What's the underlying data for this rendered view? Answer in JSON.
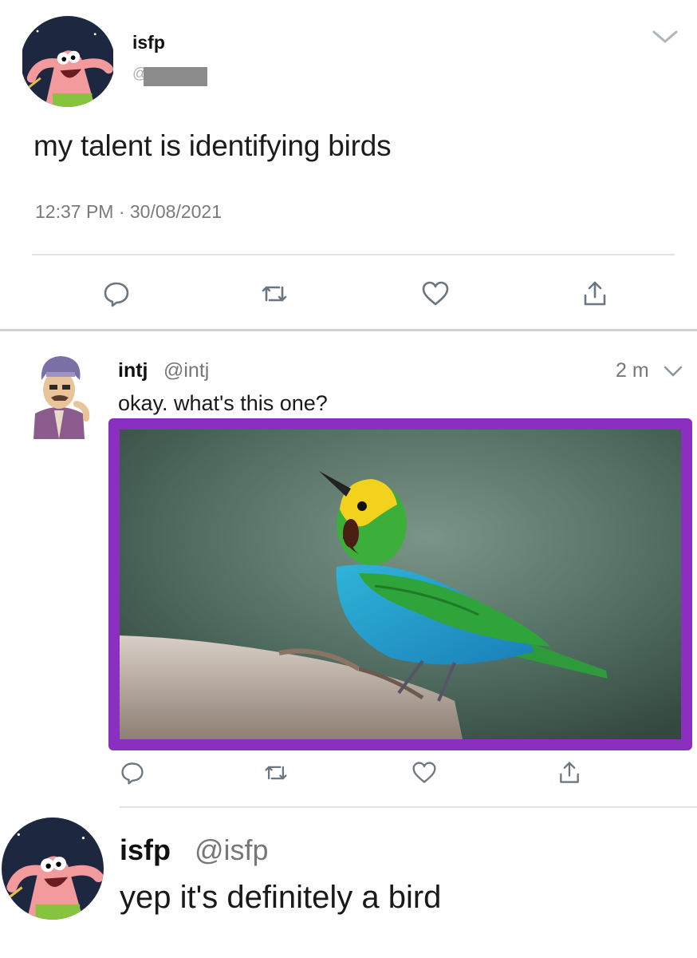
{
  "main_tweet": {
    "name": "isfp",
    "handle_prefix": "@",
    "text": "my talent is identifying birds",
    "timestamp": "12:37 PM · 30/08/2021",
    "menu_icon": "chevron-down-icon",
    "actions": [
      "reply-icon",
      "retweet-icon",
      "like-icon",
      "share-icon"
    ]
  },
  "reply_tweet": {
    "name": "intj",
    "handle": "@intj",
    "time": "2 m",
    "text": "okay. what's this one?",
    "media": "bird-photo",
    "media_border_color": "#8a2fc0",
    "actions": [
      "reply-icon",
      "retweet-icon",
      "like-icon",
      "share-icon"
    ]
  },
  "reply_tweet_2": {
    "name": "isfp",
    "handle": "@isfp",
    "text": "yep it's definitely a bird"
  }
}
